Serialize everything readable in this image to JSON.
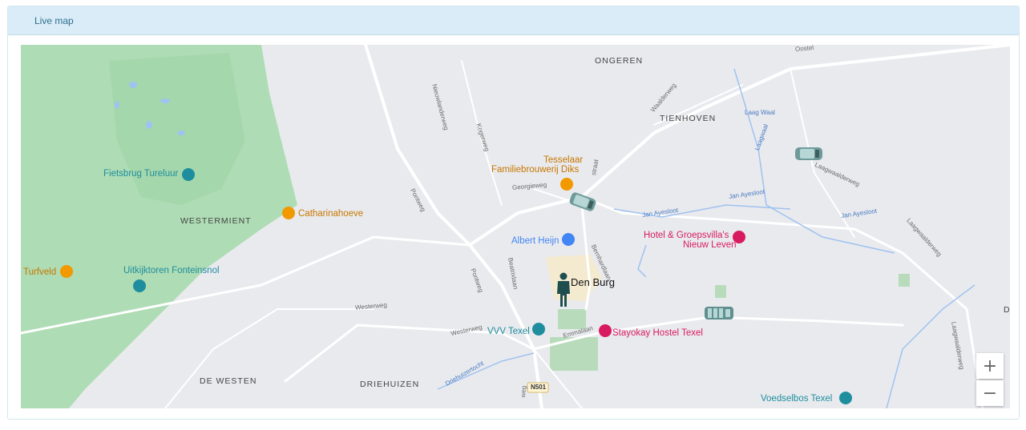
{
  "panel": {
    "title": "Live map"
  },
  "map": {
    "places": {
      "ongeren": "ONGEREN",
      "tienhoven": "TIENHOVEN",
      "westermient": "WESTERMIENT",
      "de_westen": "DE WESTEN",
      "driehuizen": "DRIEHUIZEN",
      "den_burg": "Den Burg",
      "edge_d1": "D",
      "edge_d2": "D"
    },
    "roads": {
      "nieuwlanderweg": "Nieuwlanderweg",
      "kogerweg": "Kogerweg",
      "pontweg1": "Pontweg",
      "pontweg2": "Pontweg",
      "georgieweg": "Georgieweg",
      "waalderweg": "Waalderweg",
      "laagwaalderweg": "Laagwaalderweg",
      "laagwaalderweg2": "Laagwaalderweg",
      "laagwaalderweg3": "Laagwaalderweg",
      "westerweg1": "Westerweg",
      "westerweg2": "Westerweg",
      "beatrixlaan": "Beatrixlaan",
      "bernhardlaan": "Bernhardlaan",
      "emmalaan": "Emmalaan",
      "straat": "straat",
      "oostel": "Oostel",
      "n501": "N501",
      "weg_bottom": "weg"
    },
    "water": {
      "laag_waal": "Laag Waal",
      "laagwaal": "Laagwaal",
      "jan_ayesloot1": "Jan Ayesloot",
      "jan_ayesloot2": "Jan Ayesloot",
      "jan_ayesloot3": "Jan Ayesloot",
      "driehuizertocht": "Driehuizertocht"
    },
    "pois": {
      "fietsbrug": "Fietsbrug Tureluur",
      "catharinahoeve": "Catharinahoeve",
      "turfveld": "Turfveld",
      "uitkijktoren": "Uitkijktoren Fonteinsnol",
      "tesselaar_1": "Tesselaar",
      "tesselaar_2": "Familiebrouwerij Diks",
      "albert_heijn": "Albert Heijn",
      "hotel_1": "Hotel & Groepsvilla's",
      "hotel_2": "Nieuw Leven",
      "vvv": "VVV Texel",
      "stayokay": "Stayokay Hostel Texel",
      "voedselbos": "Voedselbos Texel"
    },
    "zoom": {
      "in": "+",
      "out": "−"
    },
    "colors": {
      "green": "#c8e6c9",
      "forest": "#a8dab5",
      "road": "#ffffff",
      "water": "#9fc2f0",
      "attraction": "#1e8e9e",
      "food": "#f29900",
      "hotel": "#d81b60",
      "shop": "#4285f4"
    }
  }
}
